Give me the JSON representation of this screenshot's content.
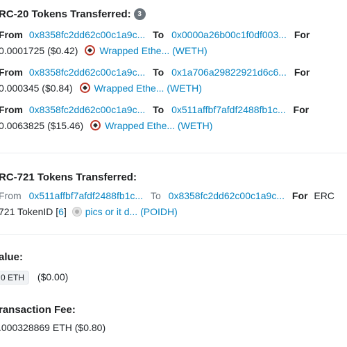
{
  "erc20": {
    "heading": "RC-20 Tokens Transferred:",
    "count": "3",
    "transfers": [
      {
        "from_label": "From",
        "from": "0x8358fc2dd62c00c1a9c...",
        "to_label": "To",
        "to": "0x0000a26b00c1f0df003...",
        "for_label": "For",
        "amount": "0.0001725 ($0.42)",
        "token": "Wrapped Ethe... (WETH)"
      },
      {
        "from_label": "From",
        "from": "0x8358fc2dd62c00c1a9c...",
        "to_label": "To",
        "to": "0x1a706a29822921d6c6...",
        "for_label": "For",
        "amount": "0.000345 ($0.84)",
        "token": "Wrapped Ethe... (WETH)"
      },
      {
        "from_label": "From",
        "from": "0x8358fc2dd62c00c1a9c...",
        "to_label": "To",
        "to": "0x511affbf7afdf2488fb1c...",
        "for_label": "For",
        "amount": "0.0063825 ($15.46)",
        "token": "Wrapped Ethe... (WETH)"
      }
    ]
  },
  "erc721": {
    "heading": "RC-721 Tokens Transferred:",
    "from_label": "From",
    "from": "0x511affbf7afdf2488fb1c...",
    "to_label": "To",
    "to": "0x8358fc2dd62c00c1a9c...",
    "for_label": "For",
    "for_value": "ERC",
    "token_id_prefix": "721 TokenID [",
    "token_id": "6",
    "token_id_suffix": "]",
    "token": "pics or it d... (POIDH)"
  },
  "value": {
    "label": "alue:",
    "eth": "0 ETH",
    "usd": "($0.00)"
  },
  "fee": {
    "label": "ransaction Fee:",
    "amount": ".000328869 ETH ($0.80)"
  },
  "icons": {
    "weth": "weth-token-icon",
    "poidh": "poidh-token-icon"
  }
}
